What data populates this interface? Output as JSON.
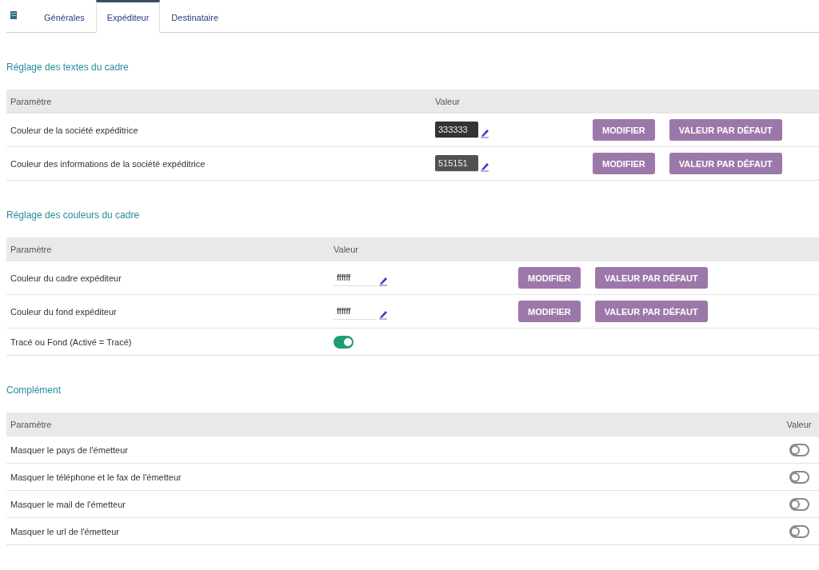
{
  "tabs": [
    {
      "label": "Générales",
      "selected": false
    },
    {
      "label": "Expéditeur",
      "selected": true
    },
    {
      "label": "Destinataire",
      "selected": false
    }
  ],
  "sections": [
    {
      "title": "Réglage des textes du cadre",
      "kind": "wide",
      "columns": [
        "Paramètre",
        "Valeur"
      ],
      "rows": [
        {
          "kind": "color",
          "label": "Couleur de la société expéditrice",
          "value": "333333",
          "color": "#333333",
          "buttons": [
            "MODIFIER",
            "VALEUR PAR DÉFAUT"
          ]
        },
        {
          "kind": "color",
          "label": "Couleur des informations de la société expéditrice",
          "value": "515151",
          "color": "#515151",
          "buttons": [
            "MODIFIER",
            "VALEUR PAR DÉFAUT"
          ]
        }
      ]
    },
    {
      "title": "Réglage des couleurs du cadre",
      "kind": "mid",
      "columns": [
        "Paramètre",
        "Valeur"
      ],
      "rows": [
        {
          "kind": "color",
          "label": "Couleur du cadre expéditeur",
          "value": "ffffff",
          "color": "#ffffff",
          "buttons": [
            "MODIFIER",
            "VALEUR PAR DÉFAUT"
          ]
        },
        {
          "kind": "color",
          "label": "Couleur du fond expéditeur",
          "value": "ffffff",
          "color": "#ffffff",
          "buttons": [
            "MODIFIER",
            "VALEUR PAR DÉFAUT"
          ]
        },
        {
          "kind": "toggle",
          "label": "Tracé ou Fond (Activé = Tracé)",
          "on": true
        }
      ]
    },
    {
      "title": "Complément",
      "kind": "right",
      "columns": [
        "Paramètre",
        "Valeur"
      ],
      "rows": [
        {
          "kind": "toggle",
          "label": "Masquer le pays de l'émetteur",
          "on": false
        },
        {
          "kind": "toggle",
          "label": "Masquer le téléphone et le fax de l'émetteur",
          "on": false
        },
        {
          "kind": "toggle",
          "label": "Masquer le mail de l'émetteur",
          "on": false
        },
        {
          "kind": "toggle",
          "label": "Masquer le url de l'émetteur",
          "on": false
        }
      ]
    }
  ]
}
